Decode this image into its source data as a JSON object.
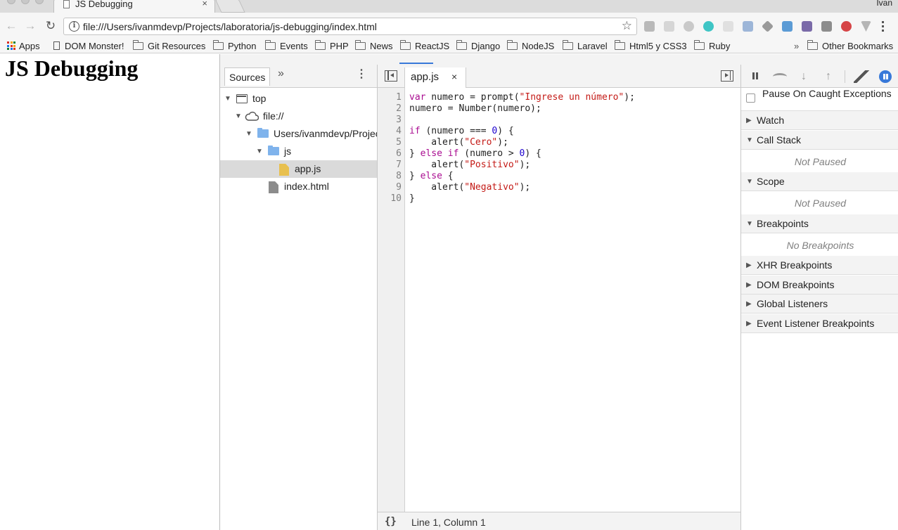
{
  "browser": {
    "tab_title": "JS Debugging",
    "tab_close": "×",
    "user_name": "Ivan",
    "url": "file:///Users/ivanmdevp/Projects/laboratoria/js-debugging/index.html",
    "nav": {
      "back": "←",
      "forward": "→",
      "reload": "↻"
    },
    "star": "☆",
    "info": "i"
  },
  "bookmarks": {
    "items": [
      "Apps",
      "DOM Monster!",
      "Git Resources",
      "Python",
      "Events",
      "PHP",
      "News",
      "ReactJS",
      "Django",
      "NodeJS",
      "Laravel",
      "Html5 y CSS3",
      "Ruby"
    ],
    "overflow": "»",
    "other": "Other Bookmarks"
  },
  "page": {
    "heading": "JS Debugging"
  },
  "devtools": {
    "navigator": {
      "tab": "Sources",
      "more": "»",
      "menu": "⋮",
      "tree": [
        "top",
        "file://",
        "Users/ivanmdevp/Projects/laboratoria/js-debugging",
        "js",
        "app.js",
        "index.html"
      ]
    },
    "editor": {
      "file_tab": "app.js",
      "close": "×",
      "line_numbers": [
        "1",
        "2",
        "3",
        "4",
        "5",
        "6",
        "7",
        "8",
        "9",
        "10"
      ],
      "code": {
        "l1": {
          "a": "var",
          "b": " numero = prompt(",
          "c": "\"Ingrese un número\"",
          "d": ");"
        },
        "l2": "numero = Number(numero);",
        "l4": {
          "a": "if",
          "b": " (numero === ",
          "c": "0",
          "d": ") {"
        },
        "l5": {
          "a": "    alert(",
          "b": "\"Cero\"",
          "c": ");"
        },
        "l6": {
          "a": "} ",
          "b": "else if",
          "c": " (numero > ",
          "d": "0",
          "e": ") {"
        },
        "l7": {
          "a": "    alert(",
          "b": "\"Positivo\"",
          "c": ");"
        },
        "l8": {
          "a": "} ",
          "b": "else",
          "c": " {"
        },
        "l9": {
          "a": "    alert(",
          "b": "\"Negativo\"",
          "c": ");"
        },
        "l10": "}"
      },
      "pretty_print": "{}",
      "cursor_position": "Line 1, Column 1"
    },
    "sidebar": {
      "pause_on_caught": "Pause On Caught Exceptions",
      "deactivate_glyph": "⁄",
      "step_into_glyph": "↓",
      "step_out_glyph": "↑",
      "sections": {
        "watch": "Watch",
        "call_stack": "Call Stack",
        "call_stack_body": "Not Paused",
        "scope": "Scope",
        "scope_body": "Not Paused",
        "breakpoints": "Breakpoints",
        "breakpoints_body": "No Breakpoints",
        "xhr": "XHR Breakpoints",
        "dom": "DOM Breakpoints",
        "global": "Global Listeners",
        "event": "Event Listener Breakpoints"
      },
      "collapsed_glyph": "▶",
      "expanded_glyph": "▼"
    }
  },
  "colors": {
    "keyword": "#aa0d91",
    "string": "#c41a16",
    "number": "#1c00cf",
    "accent": "#3879d9"
  }
}
